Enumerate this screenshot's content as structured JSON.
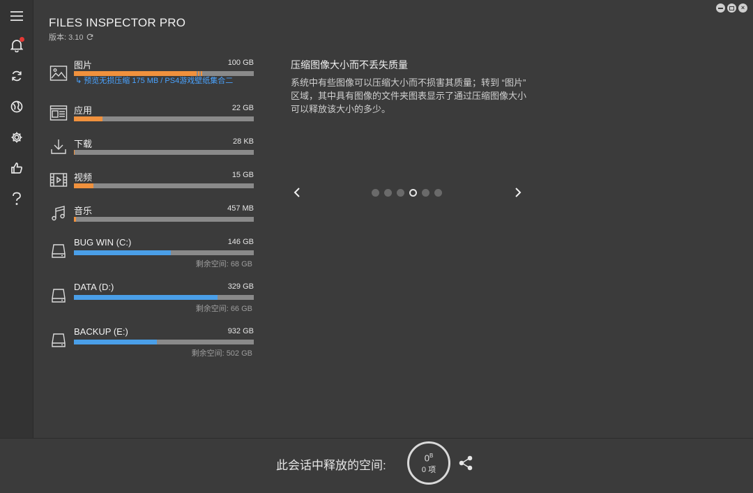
{
  "app": {
    "title": "FILES INSPECTOR PRO",
    "version": "版本: 3.10"
  },
  "sidebar": {
    "items": [
      {
        "name": "menu",
        "icon": "hamburger-menu-icon"
      },
      {
        "name": "notifications",
        "icon": "bell-icon",
        "has_badge": true
      },
      {
        "name": "refresh",
        "icon": "refresh-icon"
      },
      {
        "name": "web",
        "icon": "globe-icon"
      },
      {
        "name": "settings",
        "icon": "gear-icon"
      },
      {
        "name": "like",
        "icon": "thumbs-up-icon"
      },
      {
        "name": "help",
        "icon": "question-icon"
      }
    ]
  },
  "categories": [
    {
      "label": "图片",
      "size": "100 GB",
      "icon": "image-icon",
      "fill_pct": 68,
      "color": "#f0913d",
      "link": "预览无损压缩 175 MB / PS4游戏壁纸集合二"
    },
    {
      "label": "应用",
      "size": "22 GB",
      "icon": "apps-icon",
      "fill_pct": 16,
      "color": "#f0913d"
    },
    {
      "label": "下载",
      "size": "28 KB",
      "icon": "download-icon",
      "fill_pct": 0.5,
      "color": "#f0913d"
    },
    {
      "label": "视频",
      "size": "15 GB",
      "icon": "film-icon",
      "fill_pct": 11,
      "color": "#f0913d"
    },
    {
      "label": "音乐",
      "size": "457 MB",
      "icon": "music-icon",
      "fill_pct": 1,
      "color": "#f0913d"
    }
  ],
  "drives": [
    {
      "label": "BUG WIN (C:)",
      "size": "146 GB",
      "free": "剩余空间: 68 GB",
      "fill_pct": 54
    },
    {
      "label": "DATA (D:)",
      "size": "329 GB",
      "free": "剩余空间: 66 GB",
      "fill_pct": 80
    },
    {
      "label": "BACKUP (E:)",
      "size": "932 GB",
      "free": "剩余空间: 502 GB",
      "fill_pct": 46
    }
  ],
  "info": {
    "title": "压缩图像大小而不丢失质量",
    "body": "系统中有些图像可以压缩大小而不损害其质量；转到 “图片” 区域，其中具有图像的文件夹图表显示了通过压缩图像大小可以释放该大小的多少。",
    "dots_total": 6,
    "active_dot": 3
  },
  "footer": {
    "label": "此会话中释放的空间:",
    "bytes_value": "0",
    "bytes_unit": "B",
    "items": "0 项"
  },
  "colors": {
    "accent_orange": "#f0913d",
    "accent_blue": "#4a9fe8",
    "link": "#4aa3ff",
    "badge": "#e53935"
  }
}
